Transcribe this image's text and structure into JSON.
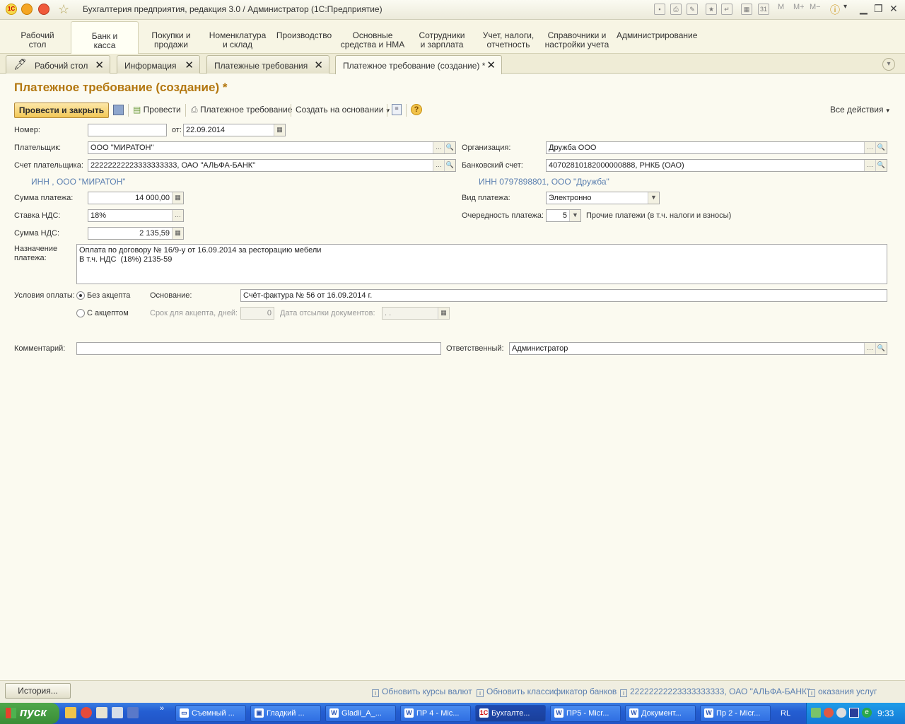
{
  "window": {
    "title": "Бухгалтерия предприятия, редакция 3.0 / Администратор  (1С:Предприятие)",
    "logo_text": "1С"
  },
  "sections": [
    {
      "label": "Рабочий\nстол"
    },
    {
      "label": "Банк и\nкасса"
    },
    {
      "label": "Покупки и\nпродажи"
    },
    {
      "label": "Номенклатура\nи склад"
    },
    {
      "label": "Производство"
    },
    {
      "label": "Основные\nсредства и НМА"
    },
    {
      "label": "Сотрудники\nи зарплата"
    },
    {
      "label": "Учет, налоги,\nотчетность"
    },
    {
      "label": "Справочники и\nнастройки учета"
    },
    {
      "label": "Администрирование"
    }
  ],
  "active_section": "Банк и касса",
  "tabs": [
    {
      "label": "Рабочий стол"
    },
    {
      "label": "Информация"
    },
    {
      "label": "Платежные требования"
    },
    {
      "label": "Платежное требование (создание) *"
    }
  ],
  "form": {
    "title": "Платежное требование (создание) *",
    "toolbar": {
      "post_close": "Провести и закрыть",
      "post": "Провести",
      "print": "Платежное требование",
      "create_based": "Создать на основании",
      "all_actions": "Все действия",
      "help": "?"
    },
    "number_label": "Номер:",
    "number_value": "",
    "date_label": "от:",
    "date_value": "22.09.2014",
    "payer_label": "Плательщик:",
    "payer_value": "ООО \"МИРАТОН\"",
    "org_label": "Организация:",
    "org_value": "Дружба ООО",
    "payer_account_label": "Счет плательщика:",
    "payer_account_value": "22222222223333333333, ОАО \"АЛЬФА-БАНК\"",
    "bank_account_label": "Банковский счет:",
    "bank_account_value": "40702810182000000888, РНКБ (ОАО)",
    "payer_inn_link": "ИНН , ООО \"МИРАТОН\"",
    "org_inn_link": "ИНН 0797898801, ООО \"Дружба\"",
    "sum_label": "Сумма платежа:",
    "sum_value": "14 000,00",
    "payment_type_label": "Вид платежа:",
    "payment_type_value": "Электронно",
    "vat_rate_label": "Ставка НДС:",
    "vat_rate_value": "18%",
    "priority_label": "Очередность платежа:",
    "priority_value": "5",
    "priority_desc": "Прочие платежи (в т.ч. налоги и взносы)",
    "vat_sum_label": "Сумма НДС:",
    "vat_sum_value": "2 135,59",
    "purpose_label": "Назначение\nплатежа:",
    "purpose_value": "Оплата по договору № 16/9-у от 16.09.2014 за ресторацию мебели\nВ т.ч. НДС  (18%) 2135-59",
    "terms_label": "Условия оплаты:",
    "without_accept": "Без акцепта",
    "with_accept": "С акцептом",
    "basis_label": "Основание:",
    "basis_value": "Счёт-фактура № 56 от 16.09.2014 г.",
    "accept_days_label": "Срок для акцепта, дней:",
    "accept_days_value": "0",
    "docs_date_label": "Дата отсылки документов:",
    "docs_date_value": " .  .",
    "comment_label": "Комментарий:",
    "comment_value": "",
    "responsible_label": "Ответственный:",
    "responsible_value": "Администратор"
  },
  "status": {
    "history": "История...",
    "notifications": [
      "Обновить курсы валют",
      "Обновить классификатор банков",
      "22222222223333333333, ОАО \"АЛЬФА-БАНК\"",
      "оказания услуг"
    ]
  },
  "taskbar": {
    "start": "пуск",
    "items": [
      {
        "label": "Съемный ..."
      },
      {
        "label": "Гладкий ..."
      },
      {
        "label": "Gladii_A_..."
      },
      {
        "label": "ПР 4 - Mic..."
      },
      {
        "label": "Бухгалте..."
      },
      {
        "label": "ПР5 - Micr..."
      },
      {
        "label": "Документ..."
      },
      {
        "label": "Пр 2 - Micr..."
      }
    ],
    "lang": "RL",
    "clock": "9:33"
  },
  "colors": {
    "title_accent": "#b3770f",
    "link": "#5b7fb0",
    "primary_button": "#f2c857",
    "taskbar": "#245ed2"
  }
}
